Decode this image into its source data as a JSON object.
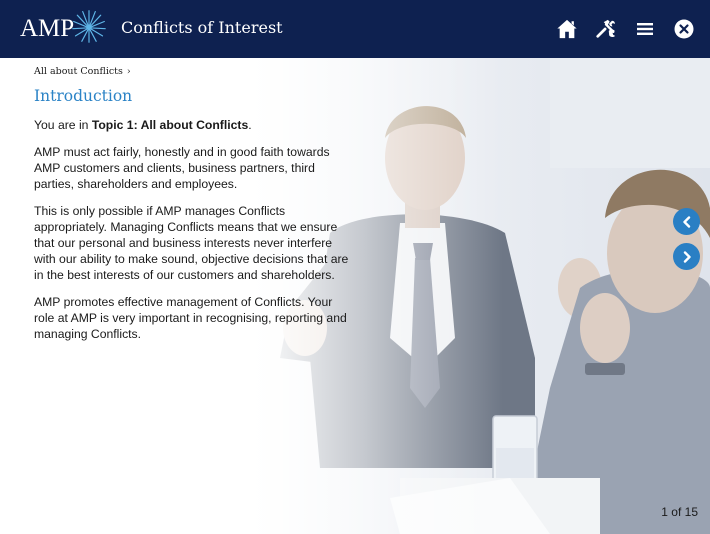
{
  "header": {
    "logo_text": "AMP",
    "title": "Conflicts of Interest",
    "buttons": [
      "home-icon",
      "tools-icon",
      "menu-icon",
      "close-icon"
    ]
  },
  "breadcrumb": {
    "label": "All about Conflicts",
    "separator": "›"
  },
  "page": {
    "heading": "Introduction",
    "intro_prefix": "You are in ",
    "intro_topic": "Topic 1: All about Conflicts",
    "intro_suffix": ".",
    "paragraphs": [
      "AMP must act fairly, honestly and in good faith towards AMP customers and clients, business partners, third parties, shareholders and employees.",
      "This is only possible if AMP manages Conflicts appropriately. Managing Conflicts means that we ensure that our personal and business interests never interfere with our ability to make sound, objective decisions that are in the best interests of our customers and shareholders.",
      "AMP promotes effective management of Conflicts. Your role at AMP is very important in recognising, reporting and managing Conflicts."
    ]
  },
  "navigation": {
    "prev_icon": "chevron-left-icon",
    "next_icon": "chevron-right-icon",
    "page_counter": "1 of 15"
  },
  "colors": {
    "header_bg": "#0e2150",
    "accent": "#2b83c6",
    "nav_button": "#2a7fc4"
  }
}
